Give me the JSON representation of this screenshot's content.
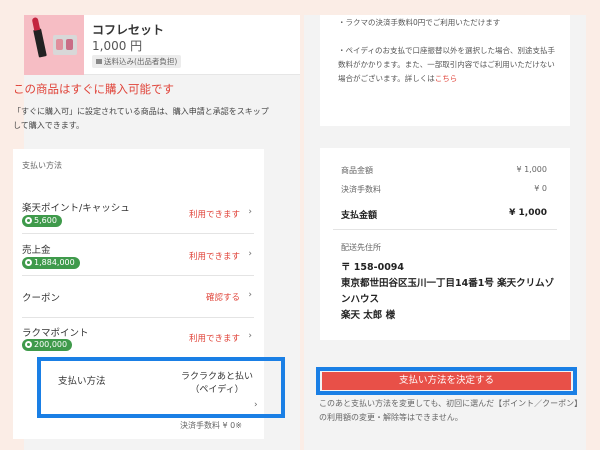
{
  "product": {
    "name": "コフレセット",
    "price": "1,000 円",
    "badge": "送料込み(出品者負担)"
  },
  "instant": {
    "title": "この商品はすぐに購入可能です",
    "description": "「すぐに購入可」に設定されている商品は、購入申請と承認をスキップして購入できます。"
  },
  "payment": {
    "section_label": "支払い方法",
    "rows": [
      {
        "label": "楽天ポイント/キャッシュ",
        "link": "利用できます",
        "pill": "5,600"
      },
      {
        "label": "売上金",
        "link": "利用できます",
        "pill": "1,884,000"
      },
      {
        "label": "クーポン",
        "link": "確認する"
      },
      {
        "label": "ラクマポイント",
        "link": "利用できます",
        "pill": "200,000"
      }
    ],
    "method_label": "支払い方法",
    "method_value_line1": "ラクラクあと払い",
    "method_value_line2": "（ペイディ）",
    "fee_note": "決済手数料 ¥ 0※"
  },
  "notes": {
    "line1": "・ラクマの決済手数料0円でご利用いただけます",
    "line2_prefix": "・ペイディのお支払で口座振替以外を選択した場合、別途支払手数料がかかります。また、一部取引内容ではご利用いただけない場合がございます。詳しくは",
    "line2_link": "こちら"
  },
  "summary": {
    "item_label": "商品金額",
    "item_value": "¥ 1,000",
    "fee_label": "決済手数料",
    "fee_value": "¥ 0",
    "total_label": "支払金額",
    "total_value": "¥ 1,000",
    "address_label": "配送先住所",
    "postal": "〒 158-0094",
    "address": "東京都世田谷区玉川一丁目14番1号 楽天クリムゾンハウス",
    "recipient": "楽天 太郎 様"
  },
  "submit": {
    "label": "支払い方法を決定する",
    "note": "このあと支払い方法を変更しても、初回に選んだ【ポイント／クーポン】の利用額の変更・解除等はできません。"
  },
  "colors": {
    "accent_red": "#e0443a",
    "highlight_blue": "#1a7fe5",
    "pill_green": "#3f9a4b",
    "background": "#fbede6"
  }
}
